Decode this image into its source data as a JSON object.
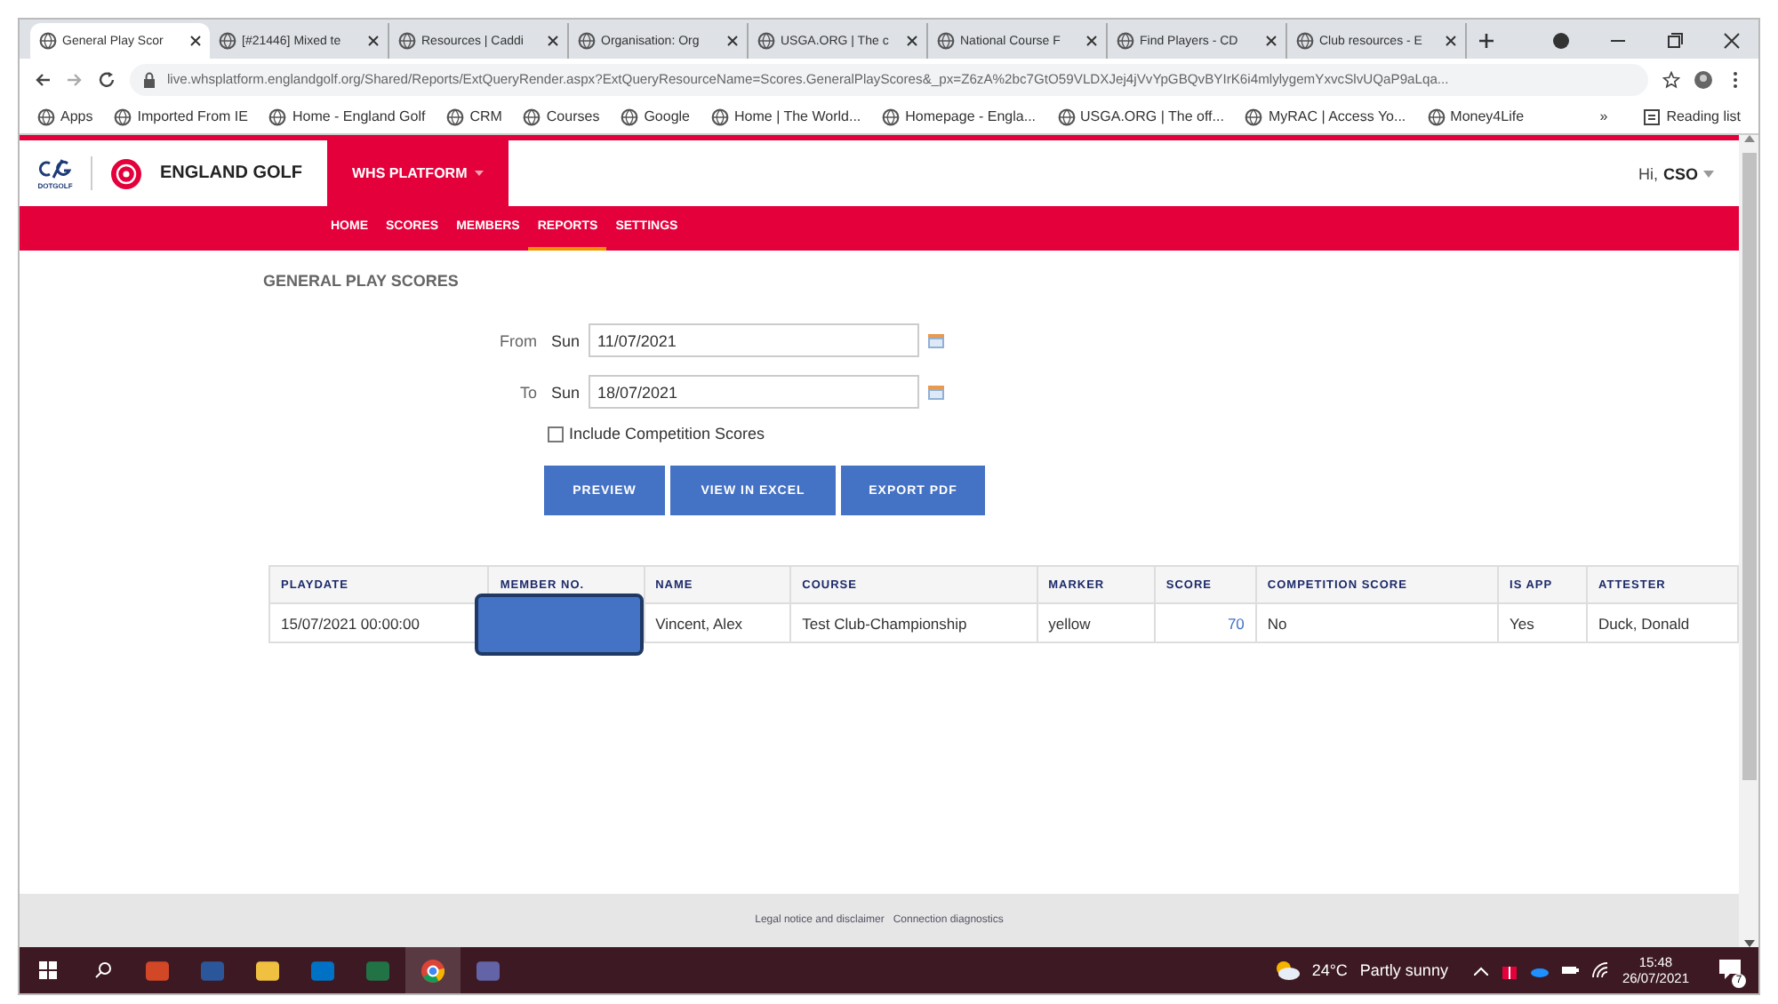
{
  "browser": {
    "tabs": [
      {
        "label": "General Play Scor",
        "selected": true
      },
      {
        "label": "[#21446] Mixed te",
        "selected": false
      },
      {
        "label": "Resources | Caddi",
        "selected": false
      },
      {
        "label": "Organisation: Org",
        "selected": false
      },
      {
        "label": "USGA.ORG | The c",
        "selected": false
      },
      {
        "label": "National Course F",
        "selected": false
      },
      {
        "label": "Find Players - CD",
        "selected": false
      },
      {
        "label": "Club resources - E",
        "selected": false
      }
    ],
    "address": "live.whsplatform.englandgolf.org/Shared/Reports/ExtQueryRender.aspx?ExtQueryResourceName=Scores.GeneralPlayScores&_px=Z6zA%2bc7GtO59VLDXJej4jVvYpGBQvBYIrK6i4mlylygemYxvcSlvUQaP9aLqa...",
    "bookmarks": [
      "Apps",
      "Imported From IE",
      "Home - England Golf",
      "CRM",
      "Courses",
      "Google",
      "Home | The World...",
      "Homepage - Engla...",
      "USGA.ORG | The off...",
      "MyRAC | Access Yo...",
      "Money4Life"
    ],
    "more_bookmarks": "»",
    "reading_list": "Reading list"
  },
  "header": {
    "logo_caption": "DOTGOLF",
    "brand": "ENGLAND GOLF",
    "platform_menu": "WHS PLATFORM",
    "greeting": "Hi,",
    "user": "CSO"
  },
  "nav": [
    {
      "label": "HOME",
      "selected": false
    },
    {
      "label": "SCORES",
      "selected": false
    },
    {
      "label": "MEMBERS",
      "selected": false
    },
    {
      "label": "REPORTS",
      "selected": true
    },
    {
      "label": "SETTINGS",
      "selected": false
    }
  ],
  "page_title": "GENERAL PLAY SCORES",
  "form": {
    "from": {
      "label": "From",
      "day": "Sun",
      "value": "11/07/2021"
    },
    "to": {
      "label": "To",
      "day": "Sun",
      "value": "18/07/2021"
    },
    "include_competition": {
      "label": "Include Competition Scores",
      "checked": false
    },
    "buttons": [
      "PREVIEW",
      "VIEW IN EXCEL",
      "EXPORT PDF"
    ]
  },
  "table": {
    "columns": [
      "PLAYDATE",
      "MEMBER NO.",
      "NAME",
      "COURSE",
      "MARKER",
      "SCORE",
      "COMPETITION SCORE",
      "IS APP",
      "ATTESTER"
    ],
    "rows": [
      {
        "playdate": "15/07/2021 00:00:00",
        "name": "Vincent, Alex",
        "course": "Test Club-Championship",
        "marker": "yellow",
        "score": "70",
        "competition_score": "No",
        "is_app": "Yes",
        "attester": "Duck, Donald"
      }
    ]
  },
  "footer": [
    "Legal notice and disclaimer",
    "Connection diagnostics"
  ],
  "taskbar": {
    "temperature": "24°C",
    "weather": "Partly sunny",
    "time": "15:48",
    "date": "26/07/2021",
    "notifications": "7"
  }
}
